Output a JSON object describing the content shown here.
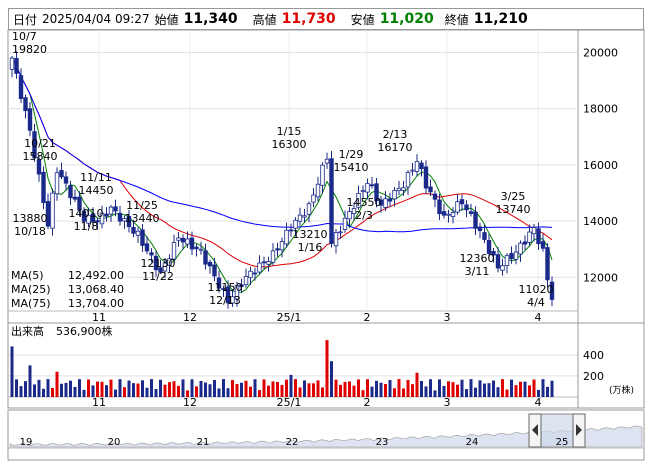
{
  "header": {
    "date_label": "日付",
    "datetime": "2025/04/04 09:27",
    "open_label": "始値",
    "open": "11,340",
    "high_label": "高値",
    "high": "11,730",
    "low_label": "安値",
    "low": "11,020",
    "close_label": "終値",
    "close": "11,210"
  },
  "colors": {
    "up": "#ffffff",
    "down": "#1b2a8a",
    "ma5": "#008000",
    "ma25": "#e00000",
    "ma75": "#0000ff",
    "vol_up": "#e00000",
    "vol_down": "#1b2a8a"
  },
  "legend": {
    "ma5_label": "MA(5)",
    "ma5_value": "12,492.00",
    "ma25_label": "MA(25)",
    "ma25_value": "13,068.40",
    "ma75_label": "MA(75)",
    "ma75_value": "13,704.00"
  },
  "volume": {
    "label": "出来高",
    "value": "536,900株",
    "unit": "(万株)"
  },
  "chart_data": {
    "type": "candlestick",
    "price_axis": {
      "ticks": [
        12000,
        14000,
        16000,
        18000,
        20000
      ],
      "range": [
        10800,
        20800
      ]
    },
    "volume_axis": {
      "ticks": [
        200,
        400
      ],
      "unit": "万株"
    },
    "x_labels": [
      "11",
      "12",
      "25/1",
      "2",
      "3",
      "4"
    ],
    "navigator_labels": [
      "19",
      "20",
      "21",
      "22",
      "23",
      "24",
      "25"
    ],
    "annotations": [
      {
        "text": "10/7",
        "text2": "19820"
      },
      {
        "text": "10/21",
        "text2": "15840"
      },
      {
        "text": "13880",
        "text2": "10/18"
      },
      {
        "text": "11/11",
        "text2": "14450"
      },
      {
        "text": "14010",
        "text2": "11/8"
      },
      {
        "text": "11/25",
        "text2": "13440"
      },
      {
        "text": "12130",
        "text2": "11/22"
      },
      {
        "text": "11150",
        "text2": "12/13"
      },
      {
        "text": "1/15",
        "text2": "16300"
      },
      {
        "text": "13210",
        "text2": "1/16"
      },
      {
        "text": "1/29",
        "text2": "15410"
      },
      {
        "text": "14550",
        "text2": "2/3"
      },
      {
        "text": "2/13",
        "text2": "16170"
      },
      {
        "text": "12360",
        "text2": "3/11"
      },
      {
        "text": "3/25",
        "text2": "13740"
      },
      {
        "text": "11020",
        "text2": "4/4"
      }
    ],
    "key_points": [
      {
        "date": "10/7",
        "high": 19820
      },
      {
        "date": "10/18",
        "low": 13880
      },
      {
        "date": "10/21",
        "high": 15840
      },
      {
        "date": "11/8",
        "low": 14010
      },
      {
        "date": "11/11",
        "high": 14450
      },
      {
        "date": "11/22",
        "low": 12130
      },
      {
        "date": "11/25",
        "high": 13440
      },
      {
        "date": "12/13",
        "low": 11150
      },
      {
        "date": "1/15",
        "high": 16300
      },
      {
        "date": "1/16",
        "low": 13210
      },
      {
        "date": "1/29",
        "high": 15410
      },
      {
        "date": "2/3",
        "low": 14550
      },
      {
        "date": "2/13",
        "high": 16170
      },
      {
        "date": "3/11",
        "low": 12360
      },
      {
        "date": "3/25",
        "high": 13740
      },
      {
        "date": "4/4",
        "low": 11020
      }
    ]
  }
}
